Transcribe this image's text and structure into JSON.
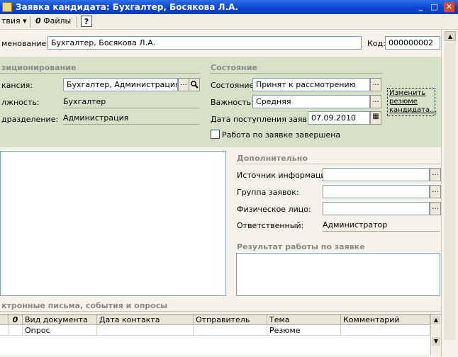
{
  "window": {
    "title": "Заявка кандидата: Бухгалтер, Босякова Л.А.",
    "min": "_",
    "max": "□",
    "close": "✕"
  },
  "toolbar": {
    "actions": "твия",
    "actions_arrow": "▾",
    "files": "Файлы",
    "help": "?"
  },
  "header": {
    "name_label": "менование:",
    "name_value": "Бухгалтер, Босякова Л.А.",
    "code_label": "Код:",
    "code_value": "000000002"
  },
  "positioning": {
    "title": "зиционирование",
    "vacancy_label": "кансия:",
    "vacancy_value": "Бухгалтер, Администрация",
    "position_label": "лжность:",
    "position_value": "Бухгалтер",
    "department_label": "дразделение:",
    "department_value": "Администрация"
  },
  "state": {
    "title": "Состояние",
    "status_label": "Состояние:",
    "status_value": "Принят к рассмотрению",
    "importance_label": "Важность:",
    "importance_value": "Средняя",
    "date_label": "Дата поступления заявки:",
    "date_value": "07.09.2010",
    "done_label": "Работа по заявке завершена",
    "change_resume_link": "Изменить резюме кандидата..."
  },
  "additional": {
    "title": "Дополнительно",
    "source_label": "Источник информации:",
    "source_value": "",
    "group_label": "Группа заявок:",
    "group_value": "",
    "person_label": "Физическое лицо:",
    "person_value": "",
    "responsible_label": "Ответственный:",
    "responsible_value": "Администратор",
    "result_title": "Результат работы по заявке"
  },
  "letters": {
    "title": "ктронные письма, события и опросы",
    "columns": [
      "",
      "Вид документа",
      "Дата контакта",
      "Отправитель",
      "Тема",
      "Комментарий"
    ],
    "rows": [
      [
        "",
        "Опрос",
        "",
        "",
        "Резюме",
        ""
      ]
    ]
  },
  "icons": {
    "dots": "...",
    "search": "🔍",
    "calendar": "▦",
    "paperclip": "0",
    "scroll_up": "▲",
    "scroll_down": "▼"
  }
}
